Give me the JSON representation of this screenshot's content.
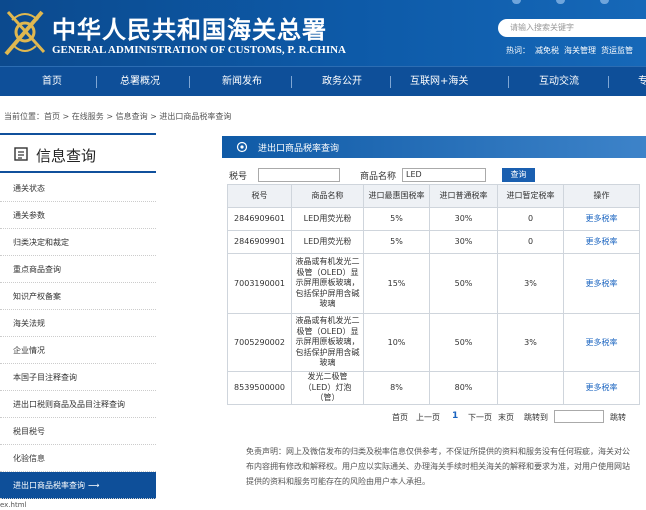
{
  "header": {
    "brand_cn": "中华人民共和国海关总署",
    "brand_en": "GENERAL ADMINISTRATION OF CUSTOMS, P. R.CHINA",
    "search_placeholder": "请输入搜索关键字",
    "hot_label": "热词：",
    "hot_words": [
      "减免税",
      "海关管理",
      "货运监管"
    ]
  },
  "nav": {
    "items": [
      "首页",
      "总署概况",
      "新闻发布",
      "政务公开",
      "互联网+海关",
      "互动交流",
      "专"
    ]
  },
  "breadcrumb": "当前位置：首页 > 在线服务 > 信息查询 > 进出口商品税率查询",
  "sidebar": {
    "title": "信息查询",
    "items": [
      {
        "label": "通关状态"
      },
      {
        "label": "通关参数"
      },
      {
        "label": "归类决定和裁定"
      },
      {
        "label": "重点商品查询"
      },
      {
        "label": "知识产权备案"
      },
      {
        "label": "海关法规"
      },
      {
        "label": "企业情况"
      },
      {
        "label": "本国子目注释查询"
      },
      {
        "label": "进出口税则商品及品目注释查询"
      },
      {
        "label": "税目税号"
      },
      {
        "label": "化验信息"
      },
      {
        "label": "进出口商品税率查询",
        "arrow": "⟶"
      }
    ]
  },
  "panel": {
    "title": "进出口商品税率查询",
    "tax_code_label": "税号",
    "tax_code_value": "",
    "name_label": "商品名称",
    "name_value": "LED",
    "query_button": "查询"
  },
  "table": {
    "headers": [
      "税号",
      "商品名称",
      "进口最惠国税率",
      "进口普通税率",
      "进口暂定税率",
      "操作"
    ],
    "rows": [
      {
        "code": "2846909601",
        "name": "LED用荧光粉",
        "mfn": "5%",
        "general": "30%",
        "provisional": "0",
        "action": "更多税率"
      },
      {
        "code": "2846909901",
        "name": "LED用荧光粉",
        "mfn": "5%",
        "general": "30%",
        "provisional": "0",
        "action": "更多税率"
      },
      {
        "code": "7003190001",
        "name": "液晶或有机发光二极管（OLED）显示屏用原板玻璃，包括保护屏用含碱玻璃",
        "mfn": "15%",
        "general": "50%",
        "provisional": "3%",
        "action": "更多税率"
      },
      {
        "code": "7005290002",
        "name": "液晶或有机发光二极管（OLED）显示屏用原板玻璃，包括保护屏用含碱玻璃",
        "mfn": "10%",
        "general": "50%",
        "provisional": "3%",
        "action": "更多税率"
      },
      {
        "code": "8539500000",
        "name": "发光二极管（LED）灯泡（管）",
        "mfn": "8%",
        "general": "80%",
        "provisional": "",
        "action": "更多税率"
      }
    ]
  },
  "pager": {
    "first": "首页",
    "prev": "上一页",
    "current": "1",
    "next": "下一页",
    "last": "末页",
    "jump": "跳转到",
    "go": "跳转"
  },
  "disclaimer": "免责声明：网上及微信发布的归类及税率信息仅供参考，不保证所提供的资料和服务没有任何瑕疵，海关对公布内容拥有修改和解释权。用户应以实际通关、办理海关手续时相关海关的解释和要求为准，对用户使用网站提供的资料和服务可能存在的风险由用户本人承担。",
  "status_bar": "ex.html",
  "colors": {
    "header_blue": "#0d5aa8",
    "nav_blue": "#0e4f99",
    "link_blue": "#1a64c0",
    "emblem_gold": "#e0b850"
  }
}
